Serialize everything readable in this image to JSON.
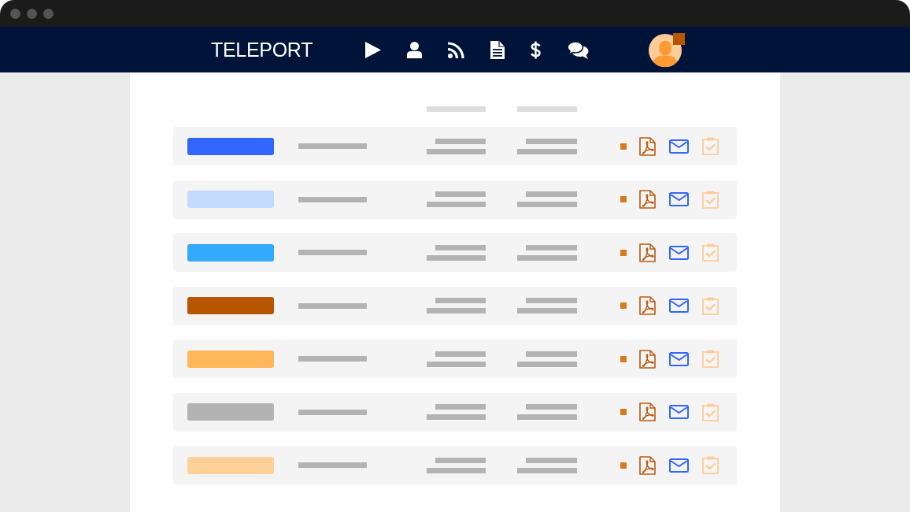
{
  "navbar": {
    "logo": "TELEPORT",
    "avatar": {
      "notification": true
    }
  },
  "table": {
    "rows": [
      {
        "color": "#3366ff"
      },
      {
        "color": "#c2dbfd"
      },
      {
        "color": "#33aaff"
      },
      {
        "color": "#b85500"
      },
      {
        "color": "#ffb75a"
      },
      {
        "color": "#b3b3b3"
      },
      {
        "color": "#ffd199"
      }
    ]
  }
}
